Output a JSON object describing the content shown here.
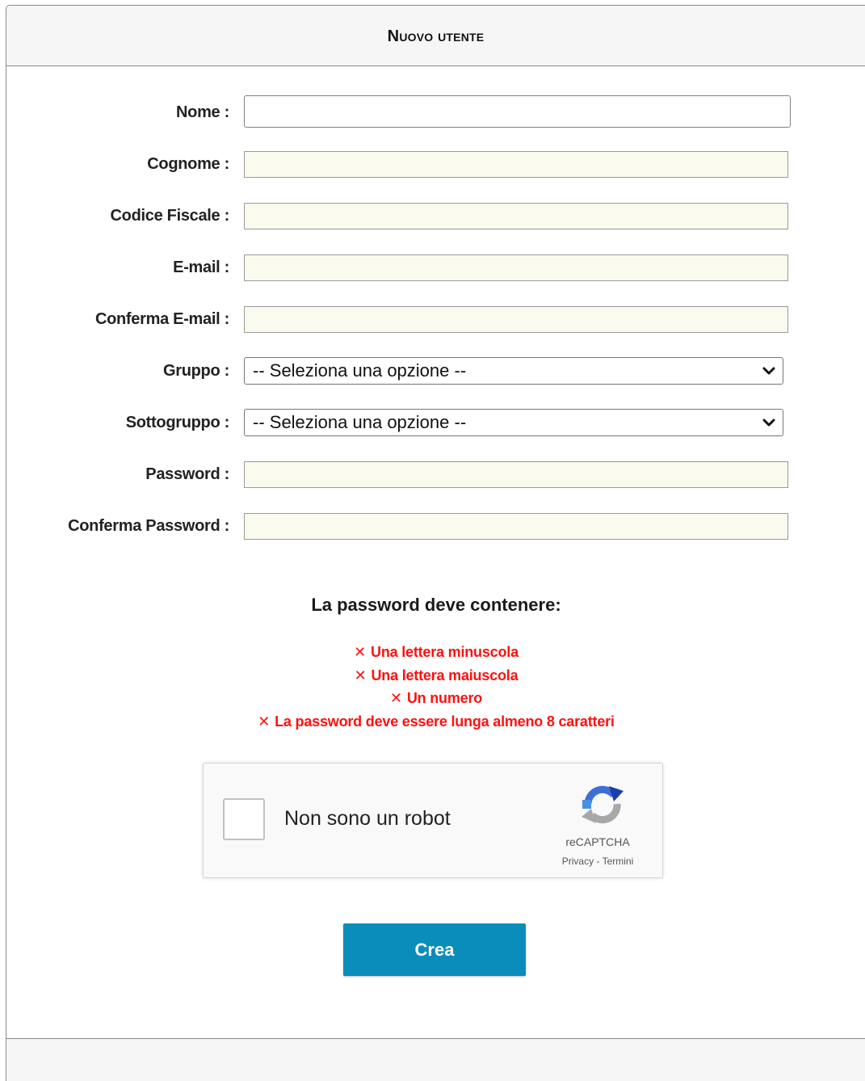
{
  "header": {
    "title": "Nuovo utente"
  },
  "form": {
    "fields": [
      {
        "label": "Nome :",
        "value": ""
      },
      {
        "label": "Cognome :",
        "value": ""
      },
      {
        "label": "Codice Fiscale :",
        "value": ""
      },
      {
        "label": "E-mail :",
        "value": ""
      },
      {
        "label": "Conferma E-mail :",
        "value": ""
      },
      {
        "label": "Gruppo :",
        "selected": "-- Seleziona una opzione --"
      },
      {
        "label": "Sottogruppo :",
        "selected": "-- Seleziona una opzione --"
      },
      {
        "label": "Password :",
        "value": ""
      },
      {
        "label": "Conferma Password :",
        "value": ""
      }
    ]
  },
  "password_rules": {
    "title": "La password deve contenere:",
    "icon": "cross-icon",
    "status_color": "#ff1010",
    "items": [
      {
        "mark": "✕",
        "text": "Una lettera minuscola"
      },
      {
        "mark": "✕",
        "text": "Una lettera maiuscola"
      },
      {
        "mark": "✕",
        "text": "Un numero"
      },
      {
        "mark": "✕",
        "text": "La password deve essere lunga almeno 8 caratteri"
      }
    ]
  },
  "captcha": {
    "label": "Non sono un robot",
    "brand": "reCAPTCHA",
    "privacy": "Privacy",
    "separator": " - ",
    "terms": "Termini",
    "icon": "recaptcha-logo-icon"
  },
  "submit": {
    "label": "Crea",
    "color": "#0b8dbb"
  }
}
